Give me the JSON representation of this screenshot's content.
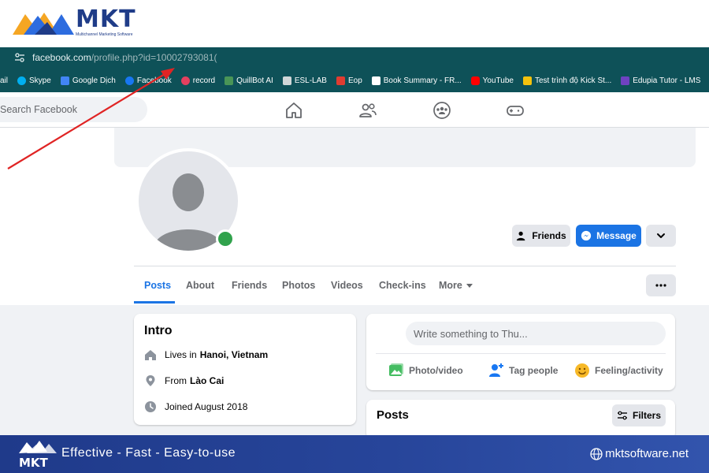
{
  "brand": {
    "name": "MKT",
    "sub": "Multichannel Marketing Software"
  },
  "browser": {
    "url_main": "facebook.com",
    "url_rest": "/profile.php?id=10002793081("
  },
  "bookmarks": [
    {
      "label": "ail",
      "color": "#0e5158"
    },
    {
      "label": "Skype",
      "color": "#00aff0"
    },
    {
      "label": "Google Dịch",
      "color": "#4285f4"
    },
    {
      "label": "Facebook",
      "color": "#1877f2"
    },
    {
      "label": "record",
      "color": "#e4405f"
    },
    {
      "label": "QuillBot AI",
      "color": "#499557"
    },
    {
      "label": "ESL-LAB",
      "color": "#d0d7d8"
    },
    {
      "label": "Eop",
      "color": "#e03c31"
    },
    {
      "label": "Book Summary - FR...",
      "color": "#ffffff"
    },
    {
      "label": "YouTube",
      "color": "#ff0000"
    },
    {
      "label": "Test trình độ Kick St...",
      "color": "#f4c20d"
    },
    {
      "label": "Edupia Tutor - LMS",
      "color": "#6f42c1"
    }
  ],
  "facebook": {
    "search_placeholder": "Search Facebook",
    "buttons": {
      "friends": "Friends",
      "message": "Message"
    },
    "tabs": [
      "Posts",
      "About",
      "Friends",
      "Photos",
      "Videos",
      "Check-ins",
      "More"
    ],
    "intro": {
      "title": "Intro",
      "lives_prefix": "Lives in",
      "lives_value": "Hanoi, Vietnam",
      "from_prefix": "From",
      "from_value": "Lào Cai",
      "joined": "Joined August 2018"
    },
    "composer": {
      "placeholder": "Write something to Thu...",
      "photo": "Photo/video",
      "tag": "Tag people",
      "feeling": "Feeling/activity"
    },
    "posts": {
      "title": "Posts",
      "filters": "Filters"
    }
  },
  "footer": {
    "tagline": "Effective - Fast - Easy-to-use",
    "site": "mktsoftware.net"
  },
  "colors": {
    "fb_blue": "#1b74e4",
    "teal_bar": "#0e5158",
    "online": "#31a24c",
    "arrow": "#e02424"
  }
}
